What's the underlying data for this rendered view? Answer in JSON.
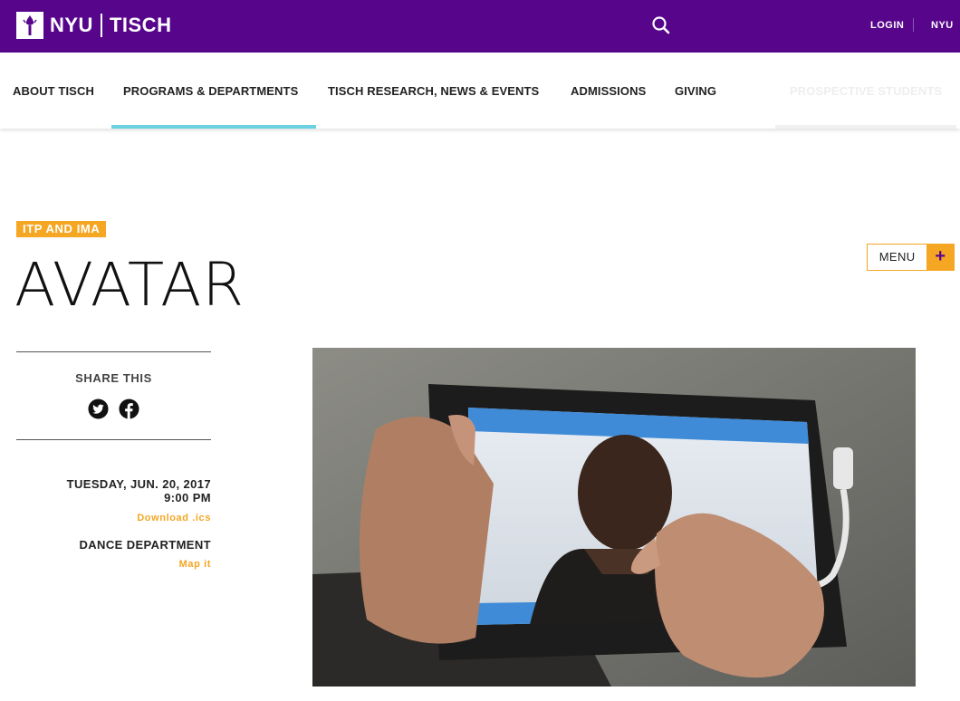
{
  "header": {
    "logo_nyu": "NYU",
    "logo_tisch": "TISCH",
    "login_label": "LOGIN",
    "nyu_link": "NYU"
  },
  "nav": {
    "items": [
      {
        "label": "ABOUT TISCH"
      },
      {
        "label": "PROGRAMS & DEPARTMENTS",
        "active": true
      },
      {
        "label": "TISCH RESEARCH, NEWS & EVENTS"
      },
      {
        "label": "ADMISSIONS"
      },
      {
        "label": "GIVING"
      },
      {
        "label": "PROSPECTIVE STUDENTS"
      }
    ]
  },
  "event": {
    "tag": "ITP AND IMA",
    "title": "AVATAR",
    "menu_label": "MENU",
    "menu_plus": "+"
  },
  "sidebar": {
    "share_label": "SHARE THIS",
    "date": "TUESDAY, JUN. 20, 2017",
    "time": "9:00 PM",
    "download_label": "Download .ics",
    "location": "DANCE DEPARTMENT",
    "map_label": "Map it"
  },
  "icons": {
    "search": "search-icon",
    "twitter": "twitter-icon",
    "facebook": "facebook-icon",
    "logo": "nyu-torch-icon"
  },
  "colors": {
    "brand_purple": "#57068c",
    "accent_orange": "#f5a623",
    "active_tab": "#6ad1e3"
  }
}
